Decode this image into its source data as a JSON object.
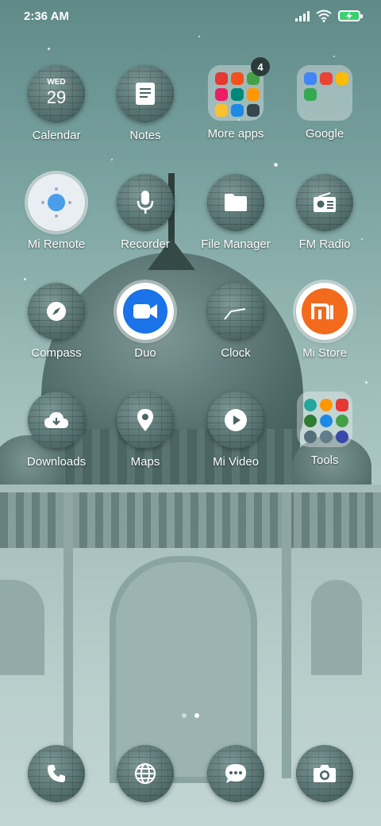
{
  "status_bar": {
    "time": "2:36 AM"
  },
  "apps": {
    "calendar": {
      "label": "Calendar",
      "weekday": "WED",
      "date": "29"
    },
    "notes": {
      "label": "Notes"
    },
    "more_apps": {
      "label": "More apps",
      "badge": "4"
    },
    "google": {
      "label": "Google"
    },
    "mi_remote": {
      "label": "Mi Remote"
    },
    "recorder": {
      "label": "Recorder"
    },
    "file_manager": {
      "label": "File Manager"
    },
    "fm_radio": {
      "label": "FM Radio"
    },
    "compass": {
      "label": "Compass"
    },
    "duo": {
      "label": "Duo"
    },
    "clock": {
      "label": "Clock"
    },
    "mi_store": {
      "label": "Mi Store"
    },
    "downloads": {
      "label": "Downloads"
    },
    "maps": {
      "label": "Maps"
    },
    "mi_video": {
      "label": "Mi Video"
    },
    "tools": {
      "label": "Tools"
    }
  },
  "dock": [
    "phone-icon",
    "browser-icon",
    "messages-icon",
    "camera-icon"
  ],
  "pages": {
    "count": 2,
    "active": 2
  },
  "colors": {
    "duo_blue": "#1a73e8",
    "mi_orange": "#f26b1d",
    "battery_green": "#3cd070"
  }
}
